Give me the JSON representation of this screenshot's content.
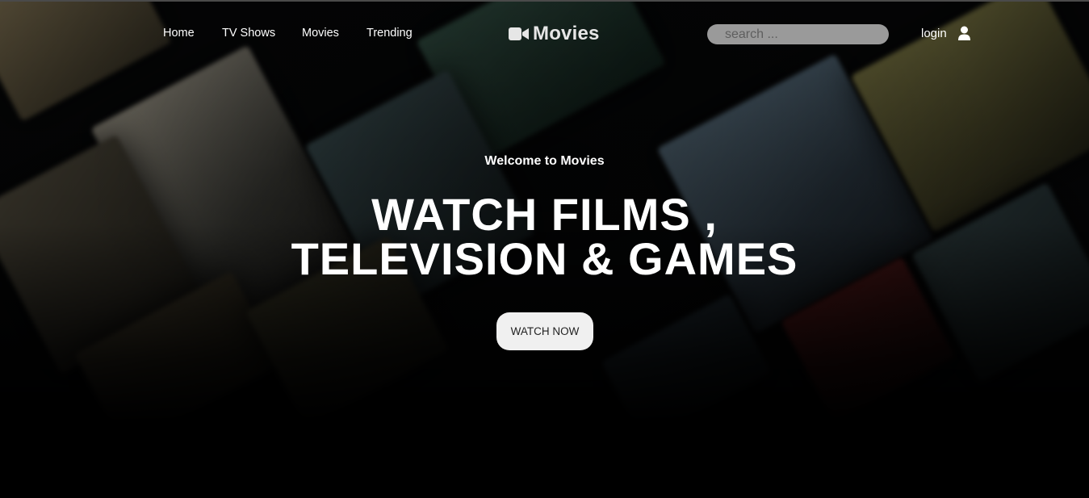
{
  "nav": {
    "items": [
      {
        "label": "Home"
      },
      {
        "label": "TV Shows"
      },
      {
        "label": "Movies"
      },
      {
        "label": "Trending"
      }
    ]
  },
  "brand": {
    "name": "Movies",
    "icon": "video-camera-icon"
  },
  "search": {
    "placeholder": "search ..."
  },
  "account": {
    "login_label": "login",
    "icon": "user-icon"
  },
  "hero": {
    "welcome": "Welcome to Movies",
    "headline_line1": "WATCH FILMS ,",
    "headline_line2": "TELEVISION & GAMES",
    "cta_label": "WATCH NOW"
  },
  "colors": {
    "background": "#000000",
    "text": "#ffffff",
    "search_bg": "#9a9a9a",
    "button_bg": "#f0f0f0"
  }
}
